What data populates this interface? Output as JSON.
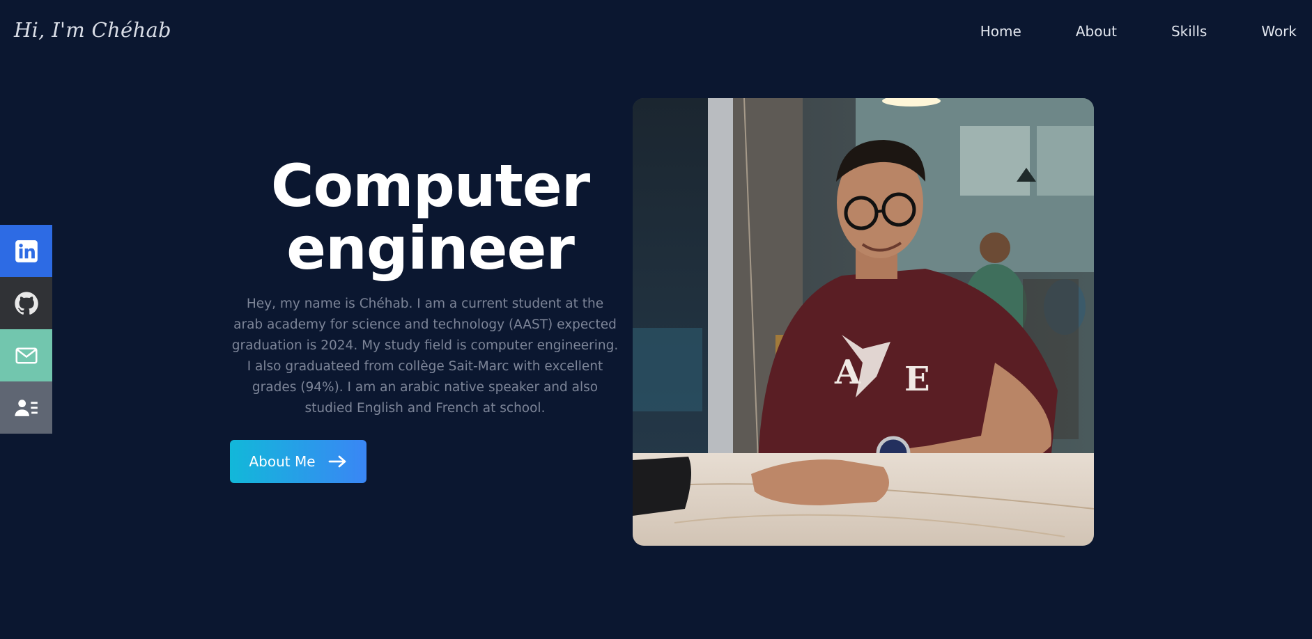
{
  "header": {
    "brand": "Hi, I'm Chéhab",
    "nav": [
      {
        "label": "Home"
      },
      {
        "label": "About"
      },
      {
        "label": "Skills"
      },
      {
        "label": "Work"
      }
    ]
  },
  "social": [
    {
      "icon": "linkedin-icon",
      "color": "#2d6be4"
    },
    {
      "icon": "github-icon",
      "color": "#303236"
    },
    {
      "icon": "mail-icon",
      "color": "#72c6ae"
    },
    {
      "icon": "contact-card-icon",
      "color": "#5f6673"
    }
  ],
  "hero": {
    "title_line1": "Computer",
    "title_line2": "engineer",
    "description": "Hey, my name is Chéhab. I am a current student at the arab academy for science and technology (AAST) expected graduation is 2024. My study field is computer engineering. I also graduateed from collège Sait-Marc with excellent grades (94%). I am an arabic native speaker and also studied English and French at school.",
    "cta_label": "About Me"
  },
  "colors": {
    "background": "#0b1730",
    "cta_gradient_start": "#12b8d9",
    "cta_gradient_end": "#3a86f5"
  }
}
